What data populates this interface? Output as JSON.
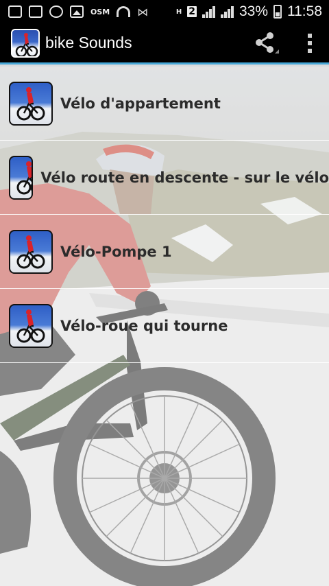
{
  "status_bar": {
    "operator_label": "OSM",
    "network_hd": "H",
    "network_badge": "2",
    "battery_percent": "33%",
    "time": "11:58"
  },
  "action_bar": {
    "title": "bike Sounds",
    "share_icon": "share-icon",
    "overflow_icon": "more-vert-icon"
  },
  "sounds": [
    {
      "label": "Vélo d'appartement"
    },
    {
      "label": "Vélo route en descente - sur le vélo"
    },
    {
      "label": "Vélo-Pompe 1"
    },
    {
      "label": "Vélo-roue qui tourne"
    }
  ],
  "colors": {
    "action_bar_bg": "#000000",
    "action_bar_divider": "#46a8d8",
    "list_text": "#2b2b2b"
  }
}
